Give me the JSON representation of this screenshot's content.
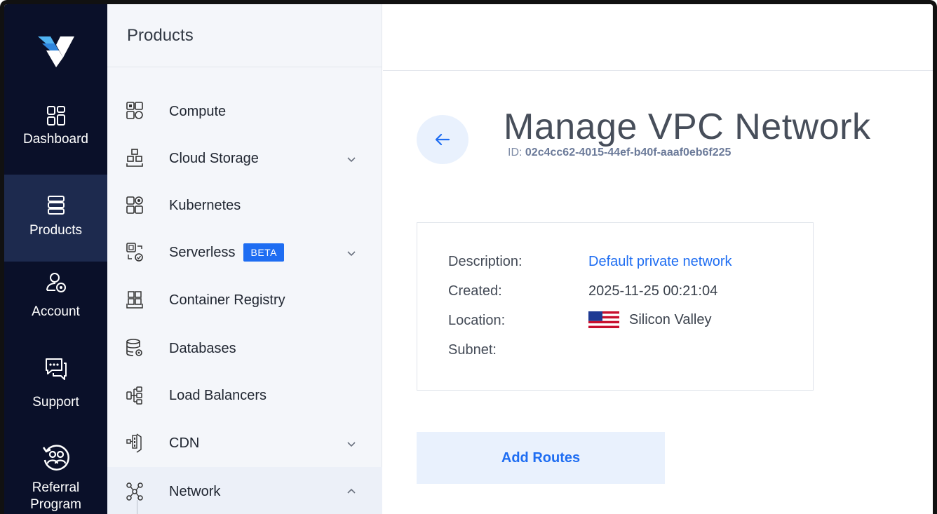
{
  "rail": {
    "items": [
      {
        "label": "Dashboard",
        "icon": "dashboard-grid-icon"
      },
      {
        "label": "Products",
        "icon": "server-stack-icon"
      },
      {
        "label": "Account",
        "icon": "user-shield-icon"
      },
      {
        "label": "Support",
        "icon": "chat-bubbles-icon"
      },
      {
        "label": "Referral\nProgram",
        "icon": "referral-people-icon"
      }
    ],
    "active": "Products"
  },
  "panel": {
    "title": "Products",
    "items": [
      {
        "label": "Compute",
        "icon": "compute-icon",
        "expandable": false
      },
      {
        "label": "Cloud Storage",
        "icon": "cloud-storage-icon",
        "expandable": true
      },
      {
        "label": "Kubernetes",
        "icon": "kubernetes-icon",
        "expandable": false
      },
      {
        "label": "Serverless",
        "icon": "serverless-icon",
        "expandable": true,
        "badge": "BETA"
      },
      {
        "label": "Container Registry",
        "icon": "container-registry-icon",
        "expandable": false
      },
      {
        "label": "Databases",
        "icon": "databases-icon",
        "expandable": false
      },
      {
        "label": "Load Balancers",
        "icon": "load-balancer-icon",
        "expandable": false
      },
      {
        "label": "CDN",
        "icon": "cdn-icon",
        "expandable": true
      },
      {
        "label": "Network",
        "icon": "network-icon",
        "expandable": true,
        "open": true
      }
    ]
  },
  "main": {
    "title": "Manage VPC Network",
    "id_prefix": "ID:",
    "id_value": "02c4cc62-4015-44ef-b40f-aaaf0eb6f225",
    "details": {
      "description_label": "Description:",
      "description_value": "Default private network",
      "created_label": "Created:",
      "created_value": "2025-11-25 00:21:04",
      "location_label": "Location:",
      "location_value": "Silicon Valley",
      "location_flag": "us-flag-icon",
      "subnet_label": "Subnet:"
    },
    "add_routes_label": "Add Routes"
  },
  "colors": {
    "rail_bg": "#0a1029",
    "accent": "#1e6df2",
    "rail_active_bar": "#3a8fff",
    "panel_bg": "#f4f6fa"
  }
}
